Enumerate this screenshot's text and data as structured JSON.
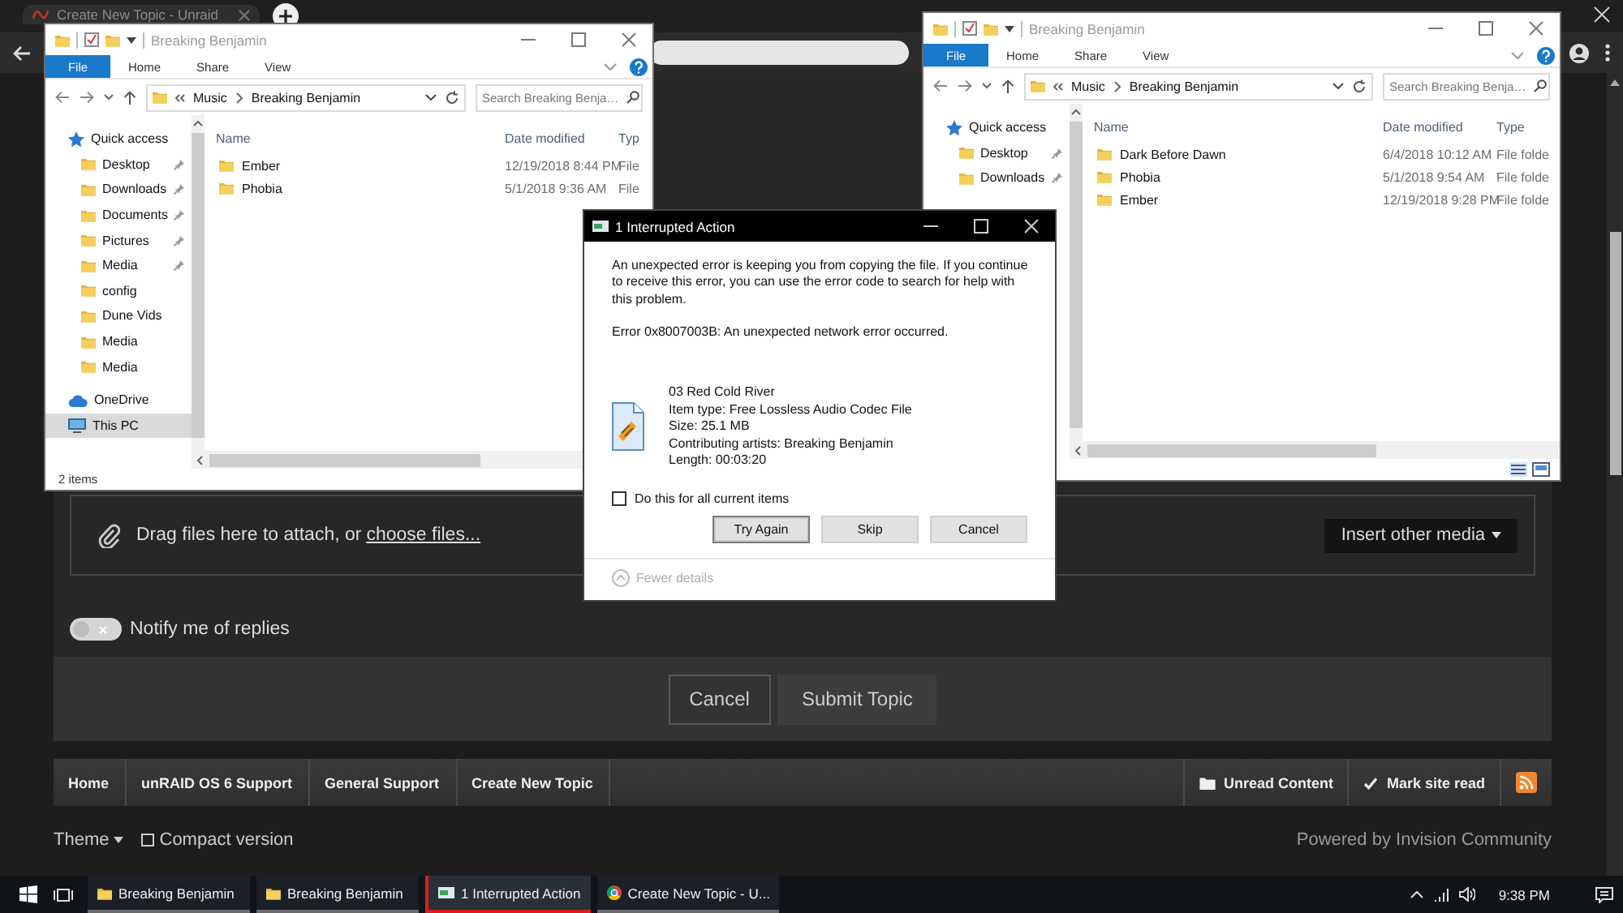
{
  "browser": {
    "tab_title": "Create New Topic - Unraid"
  },
  "forum": {
    "attach_text": "Drag files here to attach, or",
    "attach_link": "choose files...",
    "insert_media": "Insert other media",
    "notify": {
      "label": "Notify me of replies",
      "on": false
    },
    "cancel": "Cancel",
    "submit": "Submit Topic",
    "breadcrumbs": [
      "Home",
      "unRAID OS 6 Support",
      "General Support",
      "Create New Topic"
    ],
    "actions": [
      {
        "kind": "unread",
        "label": "Unread Content"
      },
      {
        "kind": "mark",
        "label": "Mark site read"
      },
      {
        "kind": "rss"
      }
    ],
    "theme": "Theme",
    "compact": {
      "label": "Compact version",
      "checked": false
    },
    "powered": "Powered by Invision Community"
  },
  "explorers": [
    {
      "title": "Breaking Benjamin",
      "ribbon_tabs": [
        {
          "label": "File",
          "kind": "file"
        },
        {
          "label": "Home",
          "kind": "tab"
        },
        {
          "label": "Share",
          "kind": "tab"
        },
        {
          "label": "View",
          "kind": "tab"
        }
      ],
      "path": [
        "Music",
        "Breaking Benjamin"
      ],
      "search_placeholder": "Search Breaking Benja…",
      "nav": [
        {
          "label": "Quick access",
          "kind": "quick",
          "selected": false,
          "children": [
            {
              "label": "Desktop",
              "kind": "folder",
              "pinned": true,
              "selected": false
            },
            {
              "label": "Downloads",
              "kind": "folder",
              "pinned": true,
              "selected": false
            },
            {
              "label": "Documents",
              "kind": "folder",
              "pinned": true,
              "selected": false
            },
            {
              "label": "Pictures",
              "kind": "folder",
              "pinned": true,
              "selected": false
            },
            {
              "label": "Media",
              "kind": "folder",
              "pinned": true,
              "selected": false
            },
            {
              "label": "config",
              "kind": "folder",
              "pinned": false,
              "selected": false
            },
            {
              "label": "Dune Vids",
              "kind": "folder",
              "pinned": false,
              "selected": false
            },
            {
              "label": "Media",
              "kind": "folder",
              "pinned": false,
              "selected": false
            },
            {
              "label": "Media",
              "kind": "folder",
              "pinned": false,
              "selected": false
            }
          ]
        },
        {
          "label": "OneDrive",
          "kind": "cloud",
          "selected": false
        },
        {
          "label": "This PC",
          "kind": "pc",
          "selected": true
        }
      ],
      "columns": [
        "Name",
        "Date modified",
        "Typ"
      ],
      "rows": [
        {
          "name": "Ember",
          "date": "12/19/2018 8:44 PM",
          "type": "File"
        },
        {
          "name": "Phobia",
          "date": "5/1/2018 9:36 AM",
          "type": "File"
        }
      ],
      "status": "2 items"
    },
    {
      "title": "Breaking Benjamin",
      "ribbon_tabs": [
        {
          "label": "File",
          "kind": "file"
        },
        {
          "label": "Home",
          "kind": "tab"
        },
        {
          "label": "Share",
          "kind": "tab"
        },
        {
          "label": "View",
          "kind": "tab"
        }
      ],
      "path": [
        "Music",
        "Breaking Benjamin"
      ],
      "search_placeholder": "Search Breaking Benja…",
      "nav": [
        {
          "label": "Quick access",
          "kind": "quick",
          "selected": false,
          "children": [
            {
              "label": "Desktop",
              "kind": "folder",
              "pinned": true,
              "selected": false
            },
            {
              "label": "Downloads",
              "kind": "folder",
              "pinned": true,
              "selected": false
            }
          ]
        }
      ],
      "columns": [
        "Name",
        "Date modified",
        "Type"
      ],
      "rows": [
        {
          "name": "Dark Before Dawn",
          "date": "6/4/2018 10:12 AM",
          "type": "File folde"
        },
        {
          "name": "Phobia",
          "date": "5/1/2018 9:54 AM",
          "type": "File folde"
        },
        {
          "name": "Ember",
          "date": "12/19/2018 9:28 PM",
          "type": "File folde"
        }
      ],
      "view_buttons": true
    }
  ],
  "dialog": {
    "title": "1 Interrupted Action",
    "message": "An unexpected error is keeping you from copying the file. If you continue to receive this error, you can use the error code to search for help with this problem.",
    "error": "Error 0x8007003B: An unexpected network error occurred.",
    "file": {
      "name": "03 Red Cold River",
      "details": [
        "Item type: Free Lossless Audio Codec File",
        "Size: 25.1 MB",
        "Contributing artists: Breaking Benjamin",
        "Length: 00:03:20"
      ]
    },
    "apply_all": {
      "label": "Do this for all current items",
      "checked": false
    },
    "buttons": [
      {
        "label": "Try Again",
        "selected": true
      },
      {
        "label": "Skip",
        "selected": false
      },
      {
        "label": "Cancel",
        "selected": false
      }
    ],
    "details_toggle": "Fewer details"
  },
  "taskbar": {
    "items": [
      {
        "label": "Breaking Benjamin",
        "kind": "folder",
        "selected": false
      },
      {
        "label": "Breaking Benjamin",
        "kind": "folder",
        "selected": false
      },
      {
        "label": "1 Interrupted Action",
        "kind": "copy",
        "selected": true
      },
      {
        "label": "Create New Topic - U...",
        "kind": "browser",
        "selected": false
      }
    ],
    "time": "9:38 PM"
  }
}
